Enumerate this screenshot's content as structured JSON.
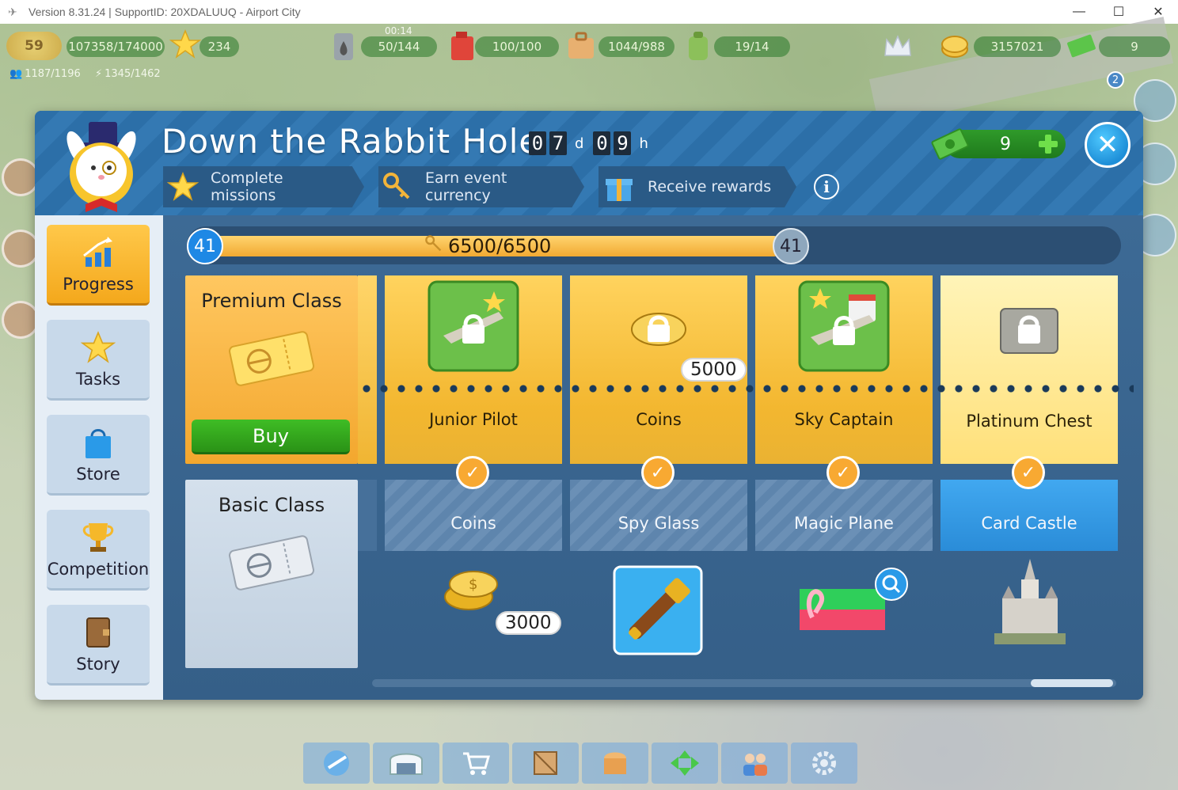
{
  "window": {
    "title": "Version 8.31.24 | SupportID: 20XDALUUQ - Airport City",
    "minimize": "—",
    "maximize": "☐",
    "close": "✕"
  },
  "hud": {
    "level": "59",
    "xp": "107358/174000",
    "stars": "234",
    "fuel_timer": "00:14",
    "fuel": "50/144",
    "gas": "100/100",
    "cargo": "1044/988",
    "crew": "19/14",
    "coins": "3157021",
    "cash": "9",
    "population": "1187/1196",
    "energy": "1345/1462",
    "right_badge": "2"
  },
  "dialog": {
    "title": "Down the Rabbit Hole",
    "timer": {
      "days_digits": [
        "0",
        "7"
      ],
      "days_unit": "d",
      "hours_digits": [
        "0",
        "9"
      ],
      "hours_unit": "h"
    },
    "steps": [
      {
        "label": "Complete missions",
        "icon": "star-icon"
      },
      {
        "label": "Earn event currency",
        "icon": "key-icon"
      },
      {
        "label": "Receive rewards",
        "icon": "gift-icon"
      }
    ],
    "info_label": "i",
    "currency_value": "9",
    "close_label": "✕"
  },
  "nav": [
    {
      "label": "Progress",
      "icon": "chart-arrow-icon",
      "active": true
    },
    {
      "label": "Tasks",
      "icon": "star-icon",
      "active": false
    },
    {
      "label": "Store",
      "icon": "shopping-bag-icon",
      "active": false
    },
    {
      "label": "Competition",
      "icon": "trophy-icon",
      "active": false
    },
    {
      "label": "Story",
      "icon": "book-icon",
      "active": false
    }
  ],
  "progress": {
    "level_current": "41",
    "level_next": "41",
    "value_text": "6500/6500",
    "fraction": 1.0
  },
  "premium_class": {
    "title": "Premium Class",
    "buy_label": "Buy"
  },
  "basic_class": {
    "title": "Basic Class"
  },
  "rewards": [
    {
      "premium_label": "Junior Pilot",
      "basic_label": "Coins",
      "basic_count": "3000",
      "premium_count": ""
    },
    {
      "premium_label": "Coins",
      "basic_label": "Spy Glass",
      "basic_count": "",
      "premium_count": "5000"
    },
    {
      "premium_label": "Sky Captain",
      "basic_label": "Magic Plane",
      "basic_count": "",
      "premium_count": ""
    },
    {
      "premium_label": "Platinum Chest",
      "basic_label": "Card Castle",
      "basic_count": "",
      "premium_count": ""
    }
  ],
  "colors": {
    "dialog_bg": "#2f5f8f",
    "header_stripe": "#2c6fa8",
    "premium_gold": "#f3b730",
    "active_nav": "#f4a81c",
    "buy_green": "#2a9216",
    "check_orange": "#f8a932"
  }
}
